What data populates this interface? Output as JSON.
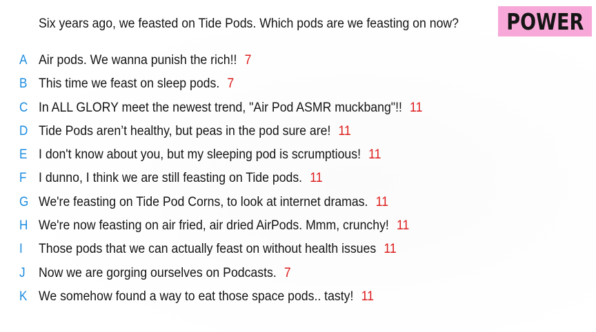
{
  "question": "Six years ago, we feasted on Tide Pods. Which pods are we feasting on now?",
  "badge": "POWER",
  "colors": {
    "letter": "#1a8be0",
    "votes": "#dd1a1a",
    "badge_background": "#f7a8d8"
  },
  "answers": [
    {
      "letter": "A",
      "text": "Air pods. We wanna punish the rich!!",
      "votes": "7"
    },
    {
      "letter": "B",
      "text": "This time we feast on sleep pods.",
      "votes": "7"
    },
    {
      "letter": "C",
      "text": "In ALL GLORY meet the newest trend, \"Air Pod ASMR muckbang\"!!",
      "votes": "11"
    },
    {
      "letter": "D",
      "text": "Tide Pods aren’t healthy, but peas in the pod sure are!",
      "votes": "11"
    },
    {
      "letter": "E",
      "text": "I don't know about you, but my sleeping pod is scrumptious!",
      "votes": "11"
    },
    {
      "letter": "F",
      "text": "I dunno, I think we are still feasting on Tide pods.",
      "votes": "11"
    },
    {
      "letter": "G",
      "text": "We're feasting on Tide Pod Corns, to look at internet dramas.",
      "votes": "11"
    },
    {
      "letter": "H",
      "text": "We're now feasting on air fried, air dried AirPods. Mmm, crunchy!",
      "votes": "11"
    },
    {
      "letter": "I",
      "text": "Those pods that we can actually feast on without health issues",
      "votes": "11"
    },
    {
      "letter": "J",
      "text": "Now we are gorging ourselves on Podcasts.",
      "votes": "7"
    },
    {
      "letter": "K",
      "text": "We somehow found a way to eat those space pods.. tasty!",
      "votes": "11"
    }
  ]
}
